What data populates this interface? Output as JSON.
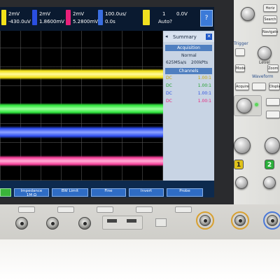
{
  "channels": [
    {
      "scale": "2mV",
      "offset": "-430.0uV",
      "color": "#f2e21a"
    },
    {
      "scale": "2mV",
      "offset": "1.8600mV",
      "color": "#34d13a"
    },
    {
      "scale": "2mV",
      "offset": "5.2800mV",
      "color": "#e8207a"
    }
  ],
  "timebase": {
    "scale": "100.0us/",
    "delay": "0.0s"
  },
  "trigger": {
    "number": "1",
    "level": "0.0V",
    "mode": "Auto?",
    "icon": "trigger-slope-icon"
  },
  "traces": [
    {
      "name": "channel-1",
      "color": "#f2e21a"
    },
    {
      "name": "channel-2",
      "color": "#2ee63c"
    },
    {
      "name": "channel-3",
      "color": "#2f4ff0"
    },
    {
      "name": "channel-4",
      "color": "#f5409a"
    }
  ],
  "summary": {
    "title": "Summary",
    "acquisition_header": "Acquisition",
    "mode": "Normal",
    "rate": "625MSa/s",
    "depth": "200kPts",
    "channels_header": "Channels",
    "rows": [
      {
        "coupling": "DC",
        "value": "1.00:1"
      },
      {
        "coupling": "DC",
        "value": "1.00:1"
      },
      {
        "coupling": "DC",
        "value": "1.00:1"
      },
      {
        "coupling": "DC",
        "value": "1.00:1"
      }
    ]
  },
  "softkeys": [
    {
      "top": "",
      "bottom": ""
    },
    {
      "top": "Impedance",
      "bottom": "1M Ω"
    },
    {
      "top": "BW Limit",
      "bottom": ""
    },
    {
      "top": "Fine",
      "bottom": ""
    },
    {
      "top": "Invert",
      "bottom": ""
    },
    {
      "top": "Probe",
      "bottom": ""
    }
  ],
  "panel": {
    "buttons": [
      "Horiz",
      "Search",
      "Navigate",
      "Level",
      "Mode",
      "Zoom",
      "Acquire",
      "Display"
    ],
    "section_trigger": "Trigger",
    "section_waveform": "Waveform",
    "channel_keys": [
      "1",
      "2"
    ]
  },
  "accent_colors": {
    "bezel": "#2a2b2e",
    "screen_bg": "#0a1f38",
    "softkey": "#2f6cc4"
  }
}
